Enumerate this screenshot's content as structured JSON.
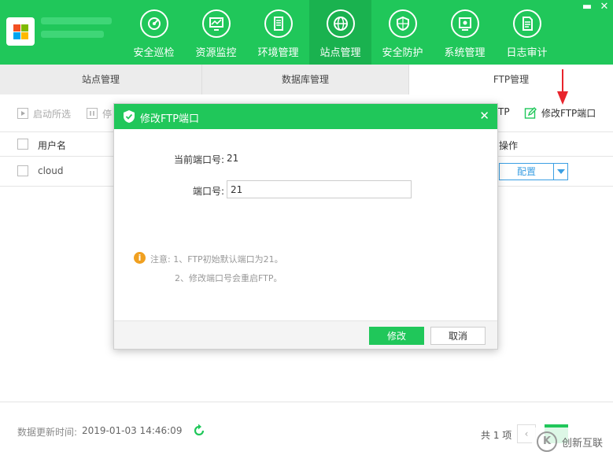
{
  "nav": {
    "items": [
      {
        "label": "安全巡检",
        "icon": "radar-icon"
      },
      {
        "label": "资源监控",
        "icon": "monitor-chart-icon"
      },
      {
        "label": "环境管理",
        "icon": "server-icon"
      },
      {
        "label": "站点管理",
        "icon": "globe-icon"
      },
      {
        "label": "安全防护",
        "icon": "shield-icon"
      },
      {
        "label": "系统管理",
        "icon": "settings-box-icon"
      },
      {
        "label": "日志审计",
        "icon": "document-icon"
      }
    ],
    "active": "站点管理"
  },
  "window": {
    "minimize": "▬",
    "close": "✕"
  },
  "tabs": [
    {
      "label": "站点管理"
    },
    {
      "label": "数据库管理"
    },
    {
      "label": "FTP管理"
    }
  ],
  "toolbar": {
    "start_selected": "启动所选",
    "stop_partial": "停",
    "ftp_partial": "TP",
    "modify_ftp_port": "修改FTP端口"
  },
  "table": {
    "headers": {
      "username": "用户名",
      "actions": "操作"
    },
    "rows": [
      {
        "username": "cloud",
        "action": "配置"
      }
    ]
  },
  "footer": {
    "update_label": "数据更新时间:",
    "update_time": "2019-01-03 14:46:09",
    "total": "共 1 项",
    "prev": "‹"
  },
  "watermark": {
    "text": "创新互联"
  },
  "modal": {
    "title": "修改FTP端口",
    "current_port_label": "当前端口号:",
    "current_port_value": "21",
    "port_label": "端口号:",
    "port_value": "21",
    "note_line1": "注意: 1、FTP初始默认端口为21。",
    "note_line2": "2、修改端口号会重启FTP。",
    "ok_label": "修改",
    "cancel_label": "取消",
    "close": "✕"
  },
  "colors": {
    "brand_green": "#20c75a",
    "link_blue": "#3b9fe3",
    "warning_orange": "#f0a020",
    "annotation_red": "#e8242c"
  }
}
